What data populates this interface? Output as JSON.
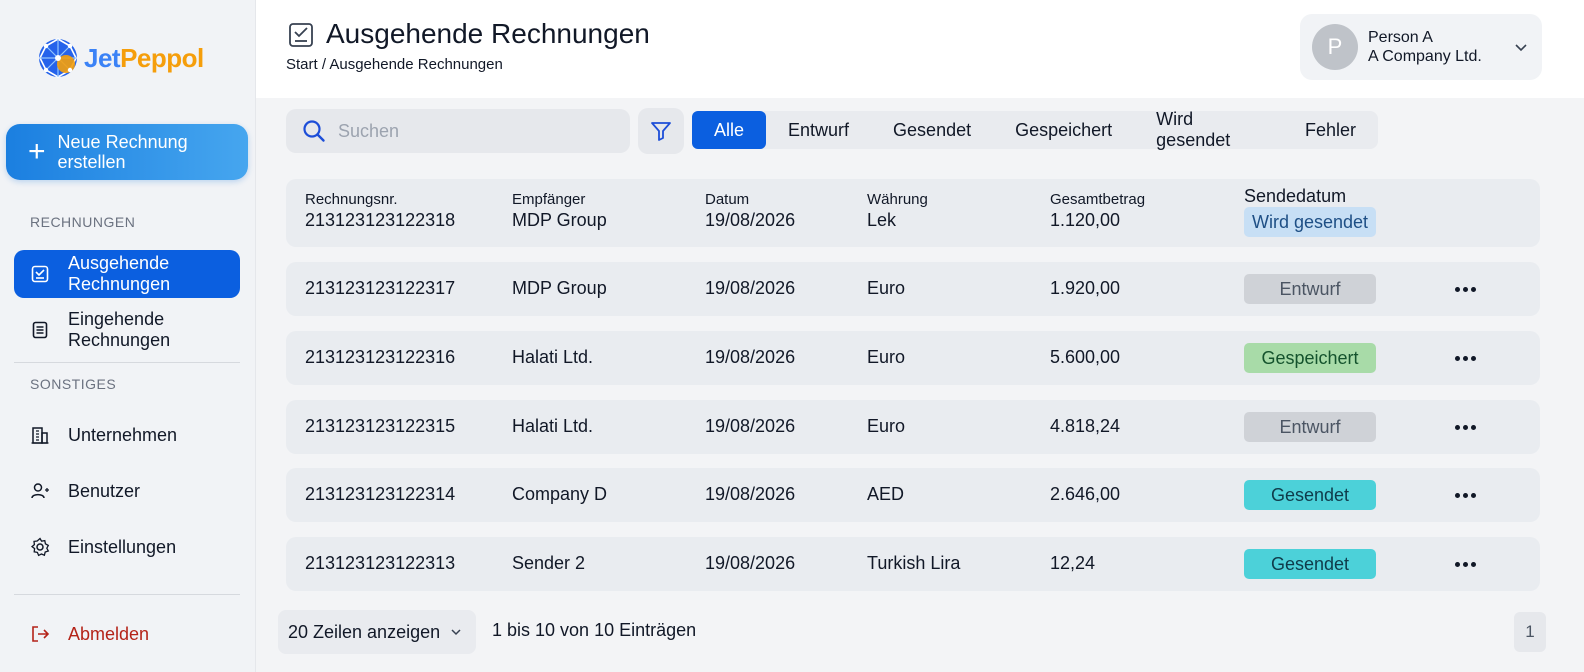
{
  "brand": {
    "name_part1": "Jet",
    "name_part2": "Peppol"
  },
  "sidebar": {
    "new_button_label": "Neue Rechnung erstellen",
    "section_invoices": "RECHNUNGEN",
    "section_other": "SONSTIGES",
    "items": [
      {
        "label": "Ausgehende Rechnungen",
        "icon": "outgoing-invoice-icon",
        "active": true
      },
      {
        "label": "Eingehende Rechnungen",
        "icon": "incoming-invoice-icon",
        "active": false
      },
      {
        "label": "Unternehmen",
        "icon": "building-icon",
        "active": false
      },
      {
        "label": "Benutzer",
        "icon": "user-icon",
        "active": false
      },
      {
        "label": "Einstellungen",
        "icon": "gear-icon",
        "active": false
      }
    ],
    "logout_label": "Abmelden"
  },
  "header": {
    "title": "Ausgehende Rechnungen",
    "breadcrumb": "Start / Ausgehende Rechnungen",
    "user": {
      "avatar_letter": "P",
      "name": "Person A",
      "company": "A Company Ltd."
    }
  },
  "toolbar": {
    "search_placeholder": "Suchen",
    "tabs": [
      "Alle",
      "Entwurf",
      "Gesendet",
      "Gespeichert",
      "Wird gesendet",
      "Fehler"
    ],
    "active_tab": "Alle"
  },
  "table": {
    "headers": {
      "number": "Rechnungsnr.",
      "recipient": "Empfänger",
      "date": "Datum",
      "currency": "Währung",
      "total": "Gesamtbetrag",
      "send_date": "Sendedatum"
    },
    "first_row": {
      "number": "213123123122318",
      "recipient": "MDP Group",
      "date": "19/08/2026",
      "currency": "Lek",
      "total": "1.120,00",
      "status": "Wird gesendet"
    },
    "rows": [
      {
        "number": "213123123122317",
        "recipient": "MDP Group",
        "date": "19/08/2026",
        "currency": "Euro",
        "total": "1.920,00",
        "status": "Entwurf"
      },
      {
        "number": "213123123122316",
        "recipient": "Halati Ltd.",
        "date": "19/08/2026",
        "currency": "Euro",
        "total": "5.600,00",
        "status": "Gespeichert"
      },
      {
        "number": "213123123122315",
        "recipient": "Halati Ltd.",
        "date": "19/08/2026",
        "currency": "Euro",
        "total": "4.818,24",
        "status": "Entwurf"
      },
      {
        "number": "213123123122314",
        "recipient": "Company D",
        "date": "19/08/2026",
        "currency": "AED",
        "total": "2.646,00",
        "status": "Gesendet"
      },
      {
        "number": "213123123122313",
        "recipient": "Sender 2",
        "date": "19/08/2026",
        "currency": "Turkish Lira",
        "total": "12,24",
        "status": "Gesendet"
      }
    ]
  },
  "footer": {
    "rows_per_page": "20 Zeilen anzeigen",
    "entries_info": "1 bis 10 von 10 Einträgen",
    "current_page": "1"
  },
  "colors": {
    "primary": "#0b5fe0",
    "brand_blue": "#3b82f6",
    "brand_orange": "#f59e0b",
    "logout": "#b42318"
  }
}
